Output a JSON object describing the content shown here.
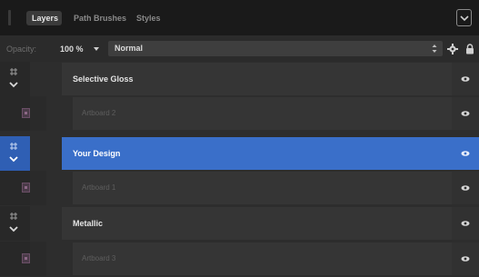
{
  "tabs": {
    "layers": "Layers",
    "path_brushes": "Path Brushes",
    "styles": "Styles"
  },
  "options": {
    "opacity_label": "Opacity:",
    "opacity_value": "100 %",
    "blend_mode": "Normal"
  },
  "layers": [
    {
      "name": "Selective Gloss",
      "type": "group",
      "selected": false
    },
    {
      "name": "Artboard 2",
      "type": "artboard",
      "selected": false
    },
    {
      "name": "Your Design",
      "type": "group",
      "selected": true
    },
    {
      "name": "Artboard 1",
      "type": "artboard",
      "selected": false
    },
    {
      "name": "Metallic",
      "type": "group",
      "selected": false
    },
    {
      "name": "Artboard 3",
      "type": "artboard",
      "selected": false
    }
  ],
  "colors": {
    "selection": "#3a6fc9",
    "panel_bg": "#2d2d2d"
  }
}
